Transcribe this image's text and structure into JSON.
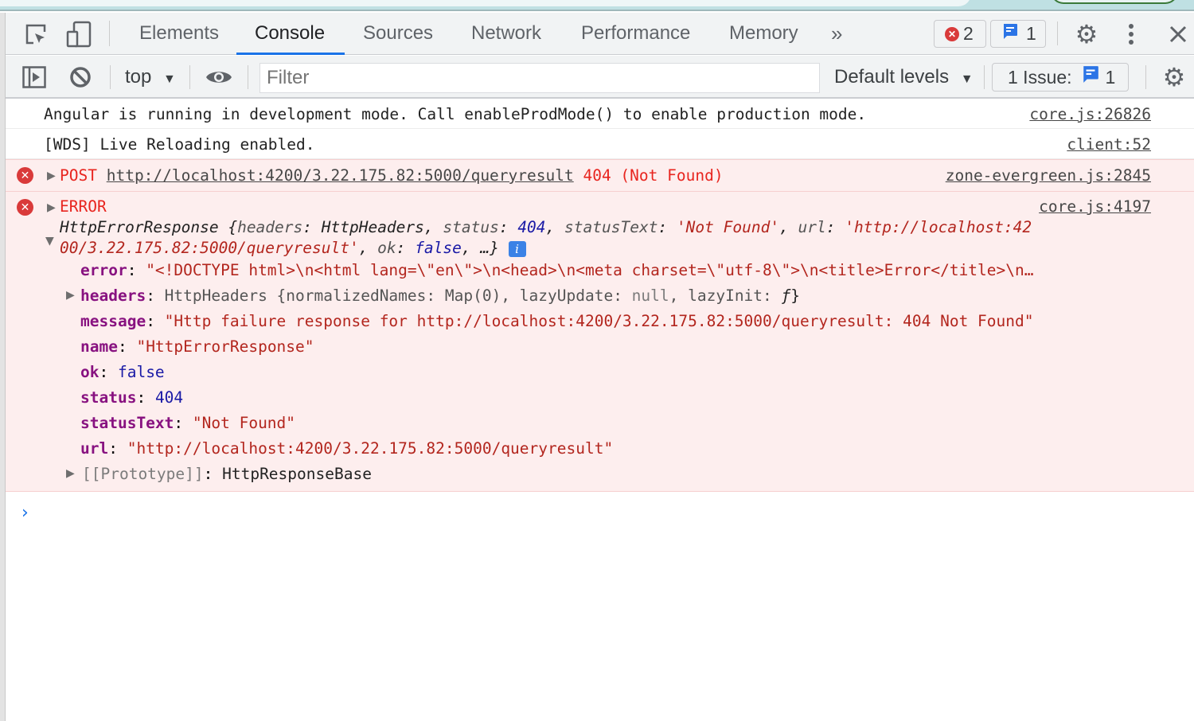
{
  "devtools": {
    "tabs": [
      {
        "label": "Elements",
        "active": false
      },
      {
        "label": "Console",
        "active": true
      },
      {
        "label": "Sources",
        "active": false
      },
      {
        "label": "Network",
        "active": false
      },
      {
        "label": "Performance",
        "active": false
      },
      {
        "label": "Memory",
        "active": false
      }
    ],
    "more_tabs_glyph": "»",
    "error_count": "2",
    "message_count": "1",
    "accent_color": "#1a73e8",
    "error_color": "#d93a3a"
  },
  "toolbar": {
    "context": "top",
    "filter_placeholder": "Filter",
    "levels": "Default levels",
    "issues_label": "1 Issue:",
    "issues_count": "1"
  },
  "console": {
    "messages": [
      {
        "type": "info",
        "text": "Angular is running in development mode. Call enableProdMode() to enable production mode.",
        "source": "core.js:26826"
      },
      {
        "type": "info",
        "text": "[WDS] Live Reloading enabled.",
        "source": "client:52"
      },
      {
        "type": "error",
        "method": "POST",
        "url": "http://localhost:4200/3.22.175.82:5000/queryresult",
        "status": "404 (Not Found)",
        "source": "zone-evergreen.js:2845"
      },
      {
        "type": "error",
        "label": "ERROR",
        "source": "core.js:4197",
        "summary": {
          "class": "HttpErrorResponse",
          "open": " {",
          "k1": "headers",
          "v1": "HttpHeaders",
          "k2": "status",
          "v2": "404",
          "k3": "statusText",
          "v3": "'Not Found'",
          "k4": "url",
          "v4a": "'http://localhost:42",
          "v4b": "00/3.22.175.82:5000/queryresult'",
          "k5": "ok",
          "v5": "false",
          "tail": ", …}"
        },
        "properties": {
          "error_key": "error",
          "error_val": "\"<!DOCTYPE html>\\n<html lang=\\\"en\\\">\\n<head>\\n<meta charset=\\\"utf-8\\\">\\n<title>Error</title>\\n…",
          "headers_key": "headers",
          "headers_val_a": "HttpHeaders {normalizedNames: Map(0), lazyUpdate: ",
          "headers_null": "null",
          "headers_val_b": ", lazyInit: ",
          "headers_f": "ƒ",
          "headers_close": "}",
          "message_key": "message",
          "message_val": "\"Http failure response for http://localhost:4200/3.22.175.82:5000/queryresult: 404 Not Found\"",
          "name_key": "name",
          "name_val": "\"HttpErrorResponse\"",
          "ok_key": "ok",
          "ok_val": "false",
          "status_key": "status",
          "status_val": "404",
          "statusText_key": "statusText",
          "statusText_val": "\"Not Found\"",
          "url_key": "url",
          "url_val": "\"http://localhost:4200/3.22.175.82:5000/queryresult\"",
          "proto_key": "[[Prototype]]",
          "proto_val": "HttpResponseBase"
        }
      }
    ],
    "prompt_glyph": "›"
  }
}
